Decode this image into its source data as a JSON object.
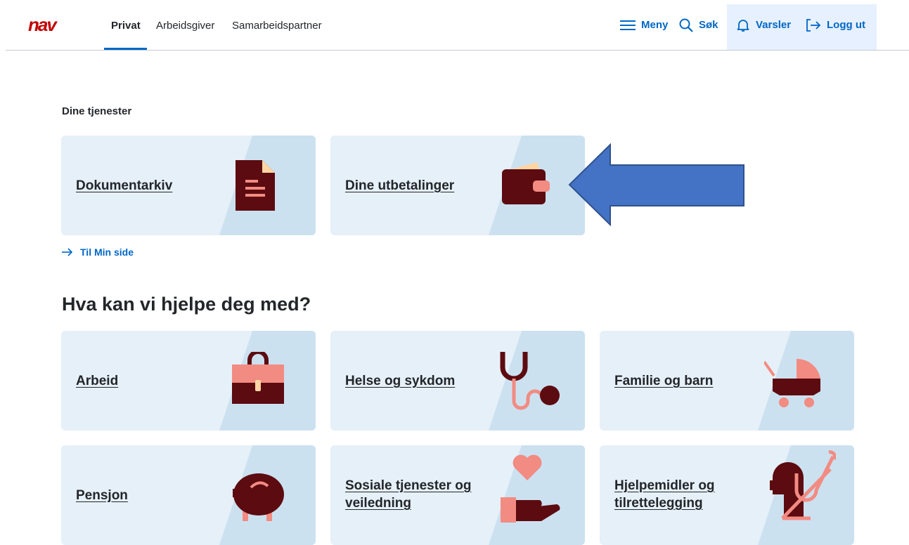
{
  "header": {
    "logo_text": "nav",
    "tabs": [
      "Privat",
      "Arbeidsgiver",
      "Samarbeidspartner"
    ],
    "active_tab": "Privat",
    "menu_label": "Meny",
    "search_label": "Søk",
    "notifications_label": "Varsler",
    "logout_label": "Logg ut"
  },
  "services": {
    "heading": "Dine tjenester",
    "cards": [
      "Dokumentarkiv",
      "Dine utbetalinger"
    ],
    "link_label": "Til Min side"
  },
  "help": {
    "heading": "Hva kan vi hjelpe deg med?",
    "cards": [
      "Arbeid",
      "Helse og sykdom",
      "Familie og barn",
      "Pensjon",
      "Sosiale tjenester og veiledning",
      "Hjelpemidler og tilrettelegging"
    ]
  },
  "colors": {
    "accent": "#0067c5",
    "card_bg": "#e6f0f8",
    "card_diag": "#cce1f0",
    "icon_dark": "#5c0b10",
    "icon_pink": "#f28b82",
    "annotation_arrow": "#4472c4"
  },
  "icons": {
    "menu": "hamburger-icon",
    "search": "search-icon",
    "notifications": "bell-icon",
    "logout": "logout-icon",
    "link": "arrow-right-icon"
  }
}
